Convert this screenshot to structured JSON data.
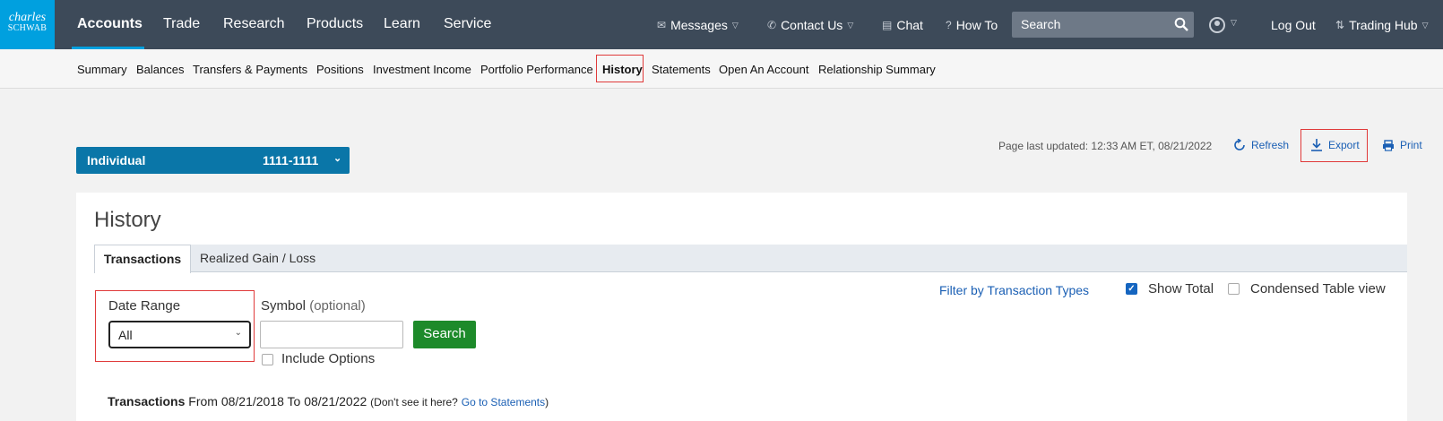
{
  "brand": {
    "line1": "charles",
    "line2": "SCHWAB"
  },
  "topnav": {
    "links": [
      "Accounts",
      "Trade",
      "Research",
      "Products",
      "Learn",
      "Service"
    ],
    "messages": "Messages",
    "contact": "Contact Us",
    "chat": "Chat",
    "howto": "How To",
    "search_placeholder": "Search",
    "logout": "Log Out",
    "trading_hub": "Trading Hub"
  },
  "subnav": {
    "links": [
      "Summary",
      "Balances",
      "Transfers & Payments",
      "Positions",
      "Investment Income",
      "Portfolio Performance",
      "History",
      "Statements",
      "Open An Account",
      "Relationship Summary"
    ],
    "active": "History"
  },
  "account": {
    "name": "Individual",
    "number": "1111-1111"
  },
  "updated": "Page last updated: 12:33 AM ET, 08/21/2022",
  "actions": {
    "refresh": "Refresh",
    "export": "Export",
    "print": "Print"
  },
  "page": {
    "title": "History",
    "tabs": [
      "Transactions",
      "Realized Gain / Loss"
    ],
    "filter_link": "Filter by Transaction Types",
    "show_total": "Show Total",
    "condensed": "Condensed Table view",
    "date_range_label": "Date Range",
    "date_range_value": "All",
    "symbol_label": "Symbol",
    "symbol_optional": "(optional)",
    "symbol_value": "",
    "search_button": "Search",
    "include_options": "Include Options",
    "tx_label": "Transactions",
    "tx_range": "From 08/21/2018 To 08/21/2022",
    "tx_note": "(Don't see it here?",
    "tx_link": "Go to Statements",
    "tx_close": ")"
  },
  "colors": {
    "topnav_bg": "#3d4a59",
    "brand_blue": "#00a0df",
    "account_bar": "#0a76a8",
    "search_green": "#1d8a2a",
    "link_blue": "#1a5fb4",
    "highlight_red": "#e03a3a"
  }
}
